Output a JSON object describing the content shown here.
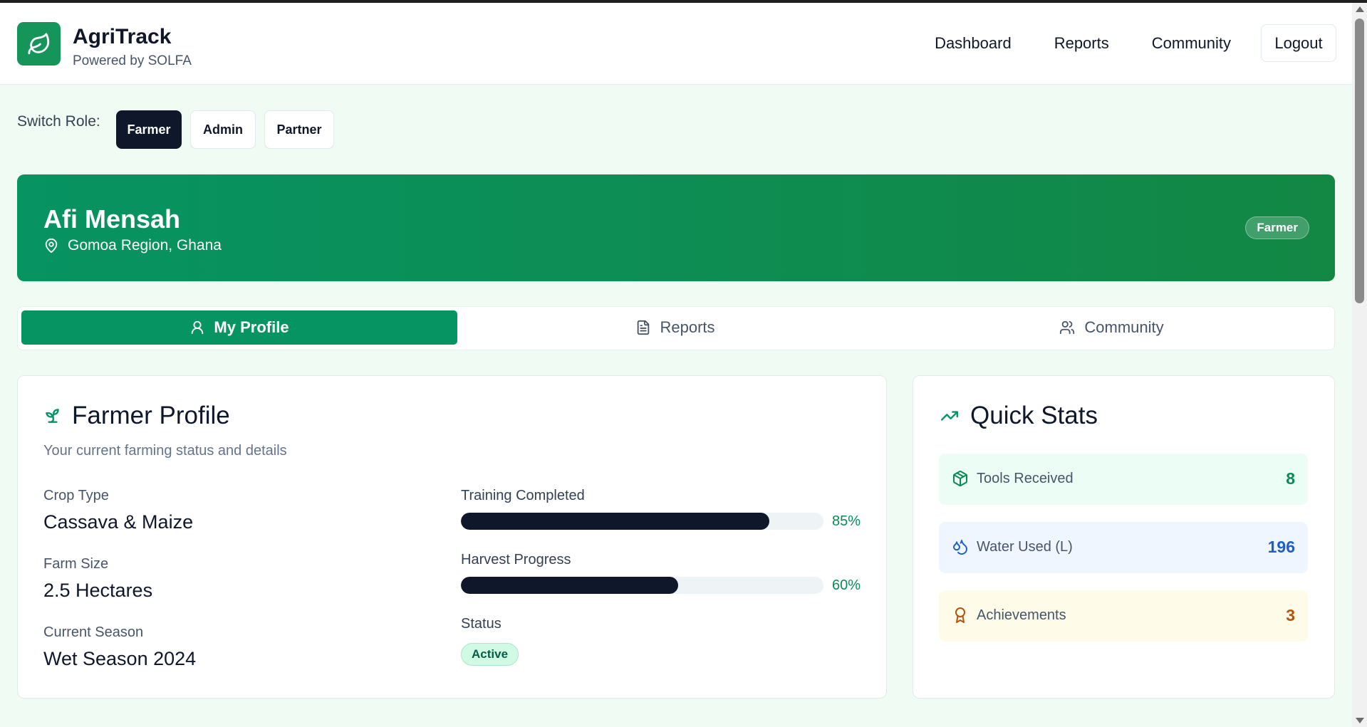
{
  "app": {
    "name": "AgriTrack",
    "tagline": "Powered by SOLFA"
  },
  "nav": {
    "items": [
      "Dashboard",
      "Reports",
      "Community"
    ],
    "logout": "Logout"
  },
  "role_switch": {
    "label": "Switch Role:",
    "roles": [
      "Farmer",
      "Admin",
      "Partner"
    ],
    "selected": "Farmer"
  },
  "hero": {
    "name": "Afi Mensah",
    "location": "Gomoa Region, Ghana",
    "badge": "Farmer"
  },
  "tabs": {
    "items": [
      {
        "label": "My Profile",
        "icon": "user-icon"
      },
      {
        "label": "Reports",
        "icon": "document-icon"
      },
      {
        "label": "Community",
        "icon": "users-icon"
      }
    ],
    "active": "My Profile"
  },
  "profile": {
    "title": "Farmer Profile",
    "subtitle": "Your current farming status and details",
    "fields": [
      {
        "label": "Crop Type",
        "value": "Cassava & Maize"
      },
      {
        "label": "Farm Size",
        "value": "2.5 Hectares"
      },
      {
        "label": "Current Season",
        "value": "Wet Season 2024"
      }
    ],
    "progress": [
      {
        "label": "Training Completed",
        "percent": 85,
        "display": "85%"
      },
      {
        "label": "Harvest Progress",
        "percent": 60,
        "display": "60%"
      }
    ],
    "status_label": "Status",
    "status_value": "Active"
  },
  "quick_stats": {
    "title": "Quick Stats",
    "items": [
      {
        "label": "Tools Received",
        "value": "8",
        "icon": "package-icon",
        "bg": "#ecfdf5",
        "color": "#0a8a57"
      },
      {
        "label": "Water Used (L)",
        "value": "196",
        "icon": "droplets-icon",
        "bg": "#eff6ff",
        "color": "#1d5fc4"
      },
      {
        "label": "Achievements",
        "value": "3",
        "icon": "award-icon",
        "bg": "#fefce8",
        "color": "#b4530a"
      }
    ]
  },
  "colors": {
    "brand": "#079463",
    "dark": "#0f172a",
    "page_bg": "#f0fbf4"
  }
}
